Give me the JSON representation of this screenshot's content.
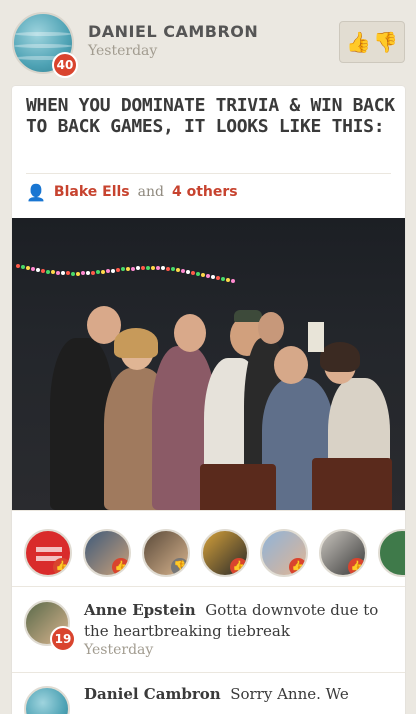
{
  "post": {
    "author": "DANIEL CAMBRON",
    "time": "Yesterday",
    "author_badge": "40",
    "title": "WHEN YOU DOMINATE TRIVIA & WIN BACK TO BACK GAMES, IT LOOKS LIKE THIS:",
    "likes": {
      "first_name": "Blake Ells",
      "connector": "and",
      "others": "4 others"
    }
  },
  "reactions": [
    {
      "type": "upvote",
      "color": "#d9442e"
    },
    {
      "type": "upvote",
      "color": "#d9442e"
    },
    {
      "type": "downvote",
      "color": "#777777"
    },
    {
      "type": "upvote",
      "color": "#d9442e"
    },
    {
      "type": "upvote",
      "color": "#d9442e"
    },
    {
      "type": "upvote",
      "color": "#d9442e"
    }
  ],
  "comments": [
    {
      "name": "Anne Epstein",
      "text": "Gotta downvote due to the heartbreaking tiebreak",
      "time": "Yesterday",
      "badge": "19"
    },
    {
      "name": "Daniel Cambron",
      "text": "Sorry Anne. We"
    }
  ],
  "colors": {
    "accent": "#c7432f",
    "badge": "#d9442e",
    "background": "#ebe8e1"
  }
}
